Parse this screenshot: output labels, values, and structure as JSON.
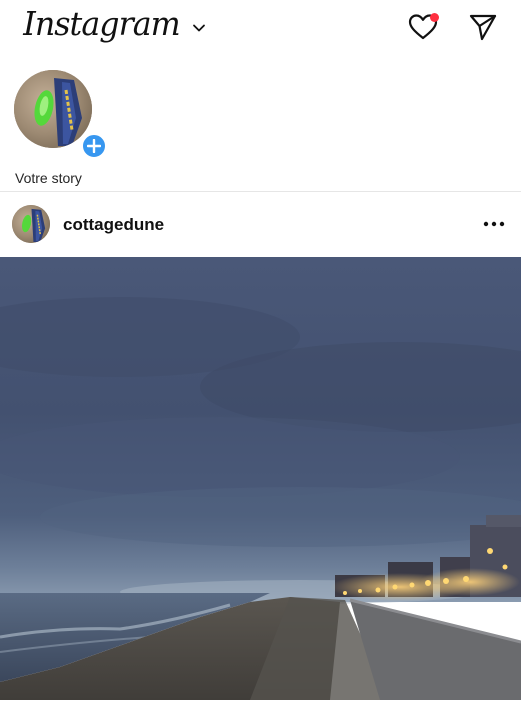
{
  "header": {
    "logo": "Instagram",
    "logo_menu_icon": "chevron-down-icon",
    "notifications_icon": "heart-icon",
    "has_unread_notifications": true,
    "messages_icon": "paper-plane-icon",
    "notification_dot_color": "#ff3040"
  },
  "stories": {
    "items": [
      {
        "label": "Votre story",
        "badge_icon": "plus-icon"
      }
    ],
    "add_badge_color": "#3797f0"
  },
  "post": {
    "username": "cottagedune",
    "more_icon": "ellipsis-icon",
    "image_alt": "Plage au crépuscule avec front de mer illuminé"
  }
}
